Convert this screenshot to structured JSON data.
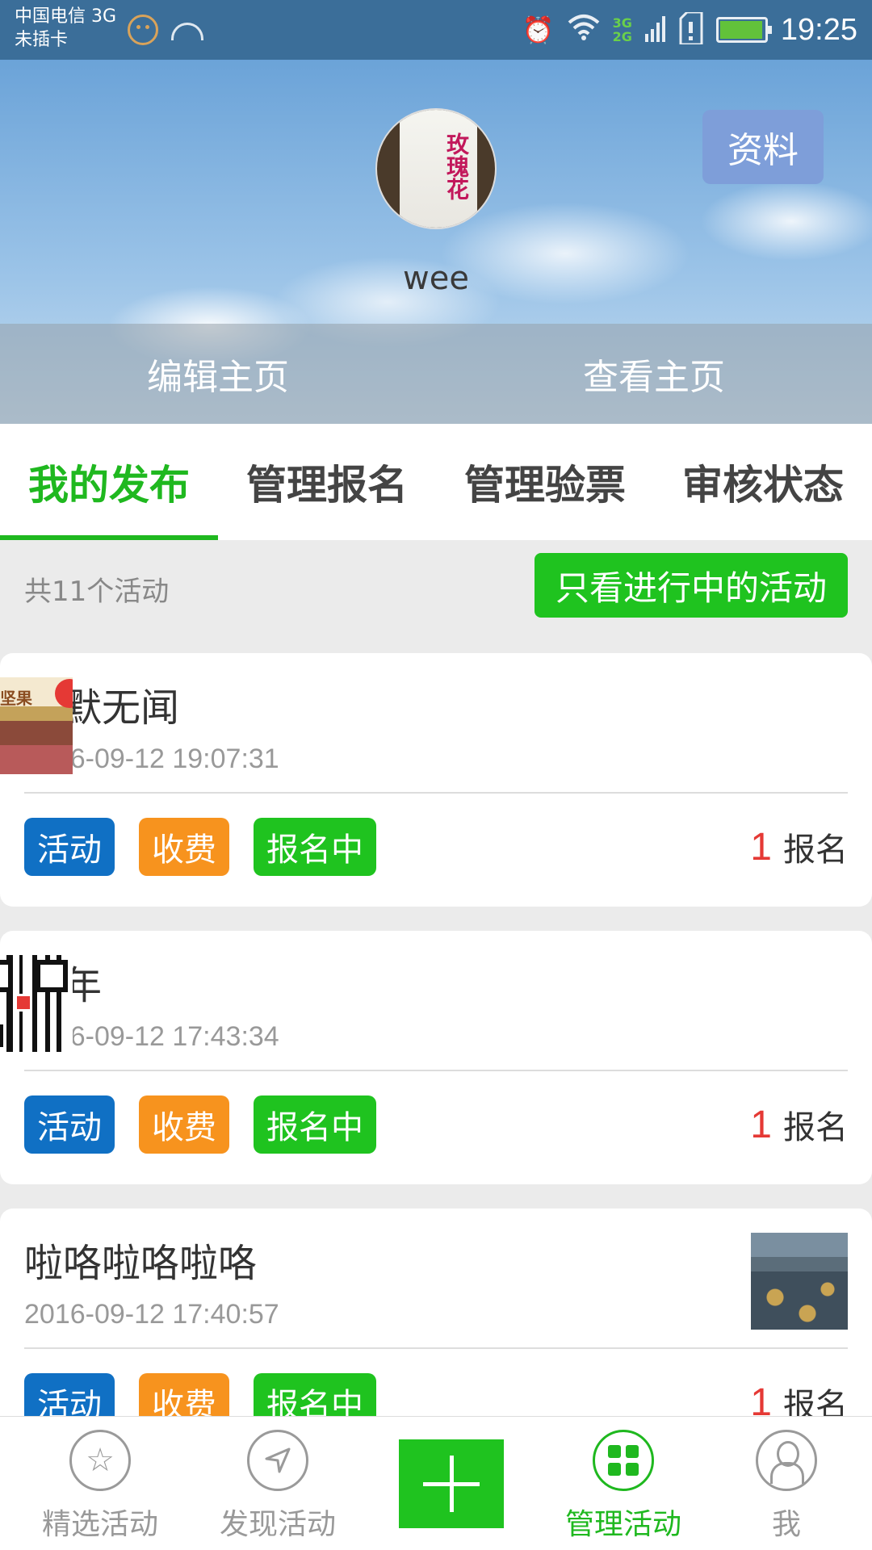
{
  "status_bar": {
    "carrier_line1": "中国电信 3G",
    "carrier_line2": "未插卡",
    "network_badge_top": "3G",
    "network_badge_bottom": "2G",
    "time": "19:25"
  },
  "header": {
    "username": "wee",
    "profile_button": "资料",
    "avatar_text": "玫瑰花",
    "edit_home": "编辑主页",
    "view_home": "查看主页"
  },
  "tabs": [
    {
      "label": "我的发布",
      "active": true
    },
    {
      "label": "管理报名",
      "active": false
    },
    {
      "label": "管理验票",
      "active": false
    },
    {
      "label": "审核状态",
      "active": false
    }
  ],
  "filter": {
    "count_text": "共11个活动",
    "only_active_button": "只看进行中的活动"
  },
  "activities": [
    {
      "title": "默默无闻",
      "date": "2016-09-12 19:07:31",
      "tags": [
        "活动",
        "收费",
        "报名中"
      ],
      "signup_count": "1",
      "signup_label": "报名",
      "thumb": "nuts-poster"
    },
    {
      "title": "今年",
      "date": "2016-09-12 17:43:34",
      "tags": [
        "活动",
        "收费",
        "报名中"
      ],
      "signup_count": "1",
      "signup_label": "报名",
      "thumb": "qr-code"
    },
    {
      "title": "啦咯啦咯啦咯",
      "date": "2016-09-12 17:40:57",
      "tags": [
        "活动",
        "收费",
        "报名中"
      ],
      "signup_count": "1",
      "signup_label": "报名",
      "thumb": "street-photo"
    }
  ],
  "bottom_nav": [
    {
      "label": "精选活动",
      "icon": "star-icon"
    },
    {
      "label": "发现活动",
      "icon": "navigation-arrow-icon"
    },
    {
      "label": "",
      "icon": "plus-icon"
    },
    {
      "label": "管理活动",
      "icon": "grid-icon",
      "active": true
    },
    {
      "label": "我",
      "icon": "person-icon"
    }
  ],
  "colors": {
    "accent_green": "#1fb81f",
    "tag_blue": "#1070c4",
    "tag_orange": "#f7931e",
    "count_red": "#e53935",
    "profile_button": "#7e9ed9"
  }
}
